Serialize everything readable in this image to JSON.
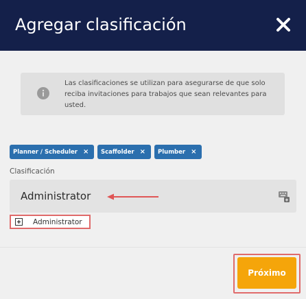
{
  "modal": {
    "title": "Agregar clasificación",
    "close_icon": "close-icon"
  },
  "info": {
    "icon": "info-icon",
    "text": "Las clasificaciones se utilizan para asegurarse de que solo reciba invitaciones para trabajos que sean relevantes para usted."
  },
  "tags": [
    {
      "label": "Planner / Scheduler",
      "remove": "×"
    },
    {
      "label": "Scaffolder",
      "remove": "×"
    },
    {
      "label": "Plumber",
      "remove": "×"
    }
  ],
  "classification": {
    "label": "Clasificación",
    "value": "Administrator",
    "keyboard_icon": "keyboard-icon"
  },
  "suggestion": {
    "icon": "plus-box-icon",
    "label": "Administrator"
  },
  "footer": {
    "next_label": "Próximo"
  },
  "colors": {
    "header_bg": "#14204a",
    "tag_bg": "#2b6fae",
    "accent": "#f5a50a",
    "highlight": "#e06a6a"
  }
}
